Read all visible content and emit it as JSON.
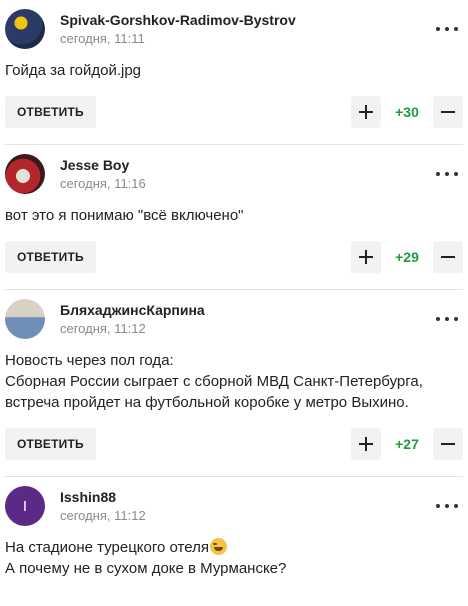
{
  "comments": [
    {
      "author": "Spivak-Gorshkov-Radimov-Bystrov",
      "time": "сегодня, 11:11",
      "lines": [
        "Гойда за гойдой.jpg"
      ],
      "reply_label": "ОТВЕТИТЬ",
      "score": "+30",
      "avatar_colors": [
        "#2b3a67",
        "#f1c40f"
      ]
    },
    {
      "author": "Jesse Boy",
      "time": "сегодня, 11:16",
      "lines": [
        "вот это я понимаю \"всё включено\""
      ],
      "reply_label": "ОТВЕТИТЬ",
      "score": "+29",
      "avatar_colors": [
        "#b3262c",
        "#e8e1d8"
      ]
    },
    {
      "author": "БляхаджинсКарпина",
      "time": "сегодня, 11:12",
      "lines": [
        "Новость через пол года:",
        "Сборная России сыграет с сборной МВД Санкт-Петербурга,",
        "встреча пройдет на футбольной коробке у метро Выхино."
      ],
      "reply_label": "ОТВЕТИТЬ",
      "score": "+27",
      "avatar_colors": [
        "#6f8fb8",
        "#d8d2c5"
      ]
    },
    {
      "author": "Isshin88",
      "time": "сегодня, 11:12",
      "lines": [
        "На стадионе турецкого отеля",
        "А почему не в сухом доке в Мурманске?"
      ],
      "avatar_letter": "I",
      "avatar_colors": [
        "#5c2a86",
        "#ffffff"
      ]
    }
  ],
  "colors": {
    "score_positive": "#1e9e3a",
    "button_bg": "#f2f2f2",
    "muted_text": "#8a8a8a"
  }
}
